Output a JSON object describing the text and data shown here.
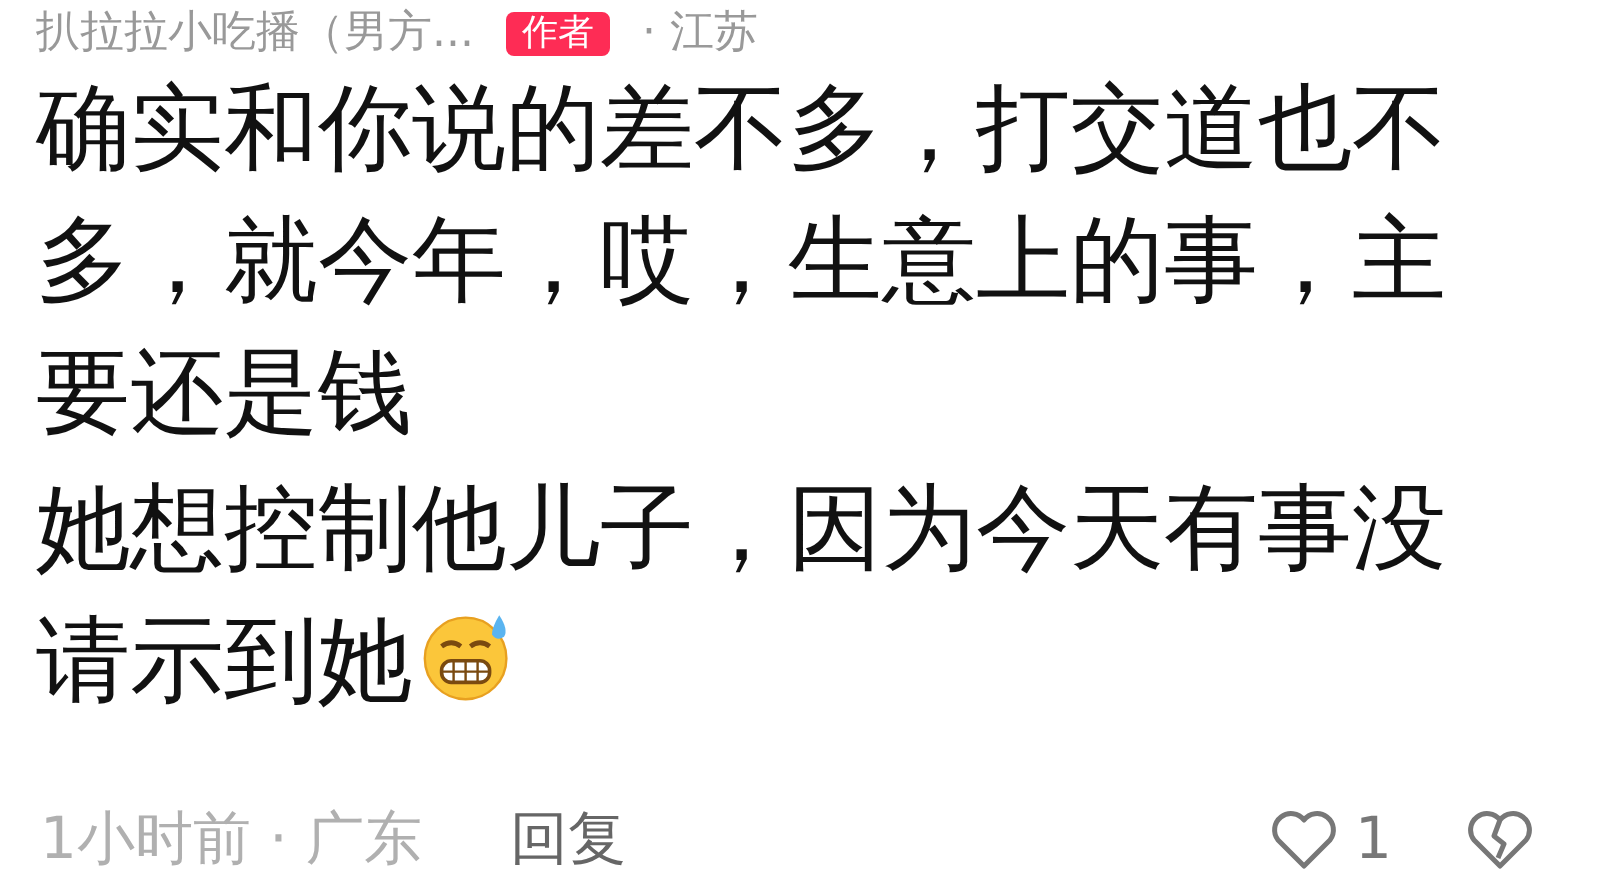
{
  "header": {
    "author": "扒拉拉小吃播（男方...",
    "badge": "作者",
    "location": "· 江苏"
  },
  "comments": [
    {
      "text": "确实和你说的差不多，打交道也不多，就今年，哎，生意上的事，主要还是钱",
      "emoji": false
    },
    {
      "text": "她想控制他儿子，因为今天有事没请示到她",
      "emoji": true
    }
  ],
  "footer": {
    "time": "1小时前 · 广东",
    "reply": "回复",
    "likes": "1"
  }
}
